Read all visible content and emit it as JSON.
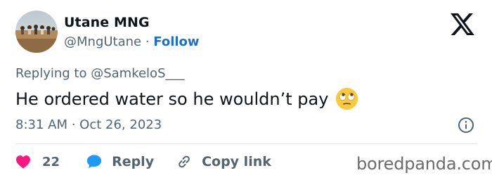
{
  "tweet": {
    "author": {
      "display_name": "Utane MNG",
      "handle": "@MngUtane",
      "separator": " · ",
      "follow_label": "Follow"
    },
    "reply_context": {
      "prefix": "Replying to ",
      "mention": "@SamkeloS___"
    },
    "text": "He ordered water so he wouldn’t pay",
    "emoji": "face-with-rolling-eyes",
    "time": "8:31 AM",
    "date_separator": " · ",
    "date": "Oct 26, 2023",
    "actions": {
      "like_count": "22",
      "reply_label": "Reply",
      "copy_link_label": "Copy link"
    }
  },
  "watermark": "boredpanda.com",
  "colors": {
    "text_primary": "#0f1419",
    "text_secondary": "#536471",
    "follow_link": "#1d70c9",
    "like_heart": "#f91880",
    "reply_bubble": "#1d9bf0",
    "divider": "#dfe3e6"
  },
  "icons": {
    "logo": "x-logo-icon",
    "info": "info-icon",
    "like": "heart-icon",
    "reply": "speech-bubble-icon",
    "copy_link": "link-icon"
  }
}
